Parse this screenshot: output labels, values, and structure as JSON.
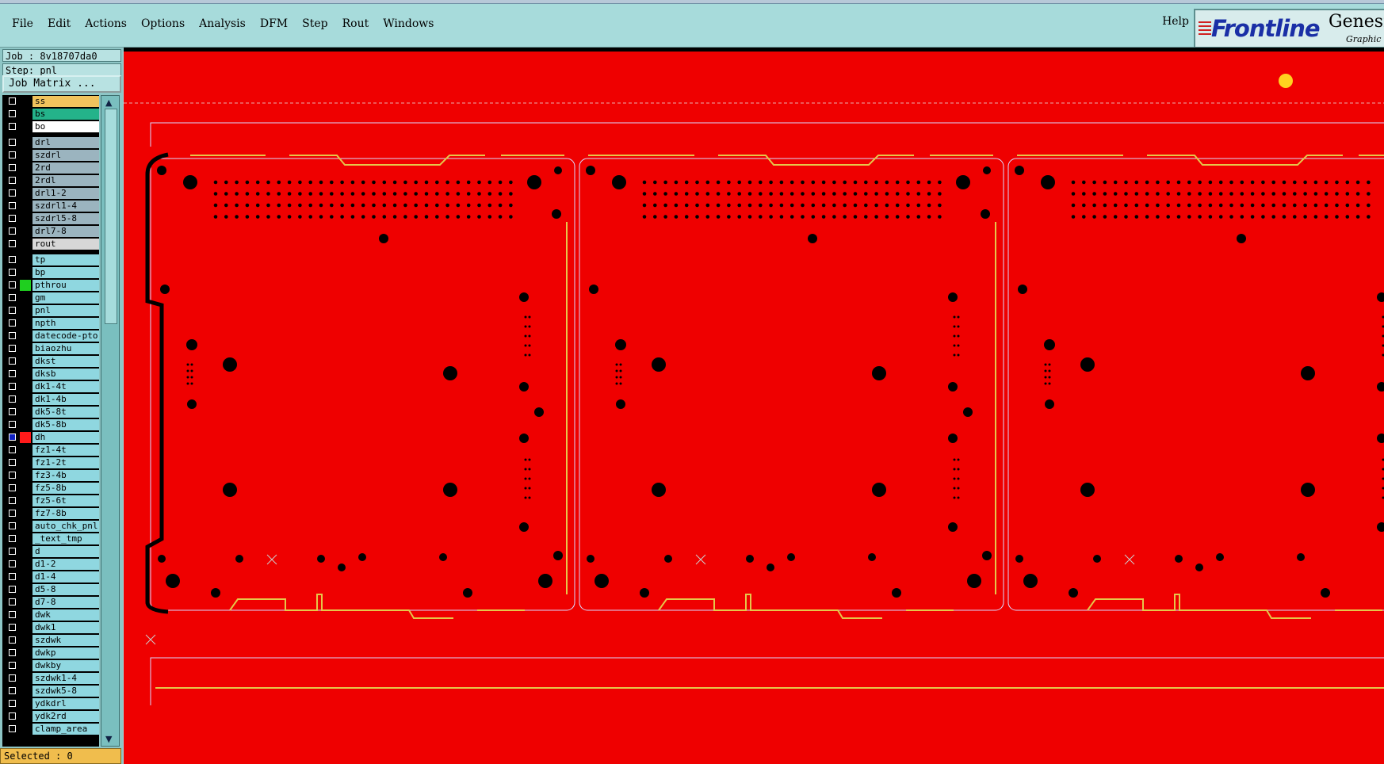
{
  "menu": [
    "File",
    "Edit",
    "Actions",
    "Options",
    "Analysis",
    "DFM",
    "Step",
    "Rout",
    "Windows"
  ],
  "help": "Help",
  "brand": {
    "logo": "Frontline",
    "product": "Genesi",
    "sub": "Graphic"
  },
  "job_label": "Job : 8v18707da0",
  "step_label": "Step: pnl",
  "matrix_button": "Job Matrix ...",
  "selected": "Selected : 0",
  "layers": [
    {
      "name": "ss",
      "color": "#f1c35d"
    },
    {
      "name": "bs",
      "color": "#24b38a"
    },
    {
      "name": "bo",
      "color": "#ffffff"
    },
    {
      "name": "drl",
      "color": "#9bb4bf"
    },
    {
      "name": "szdrl",
      "color": "#9bb4bf"
    },
    {
      "name": "2rd",
      "color": "#9bb4bf"
    },
    {
      "name": "2rdl",
      "color": "#9bb4bf"
    },
    {
      "name": "drl1-2",
      "color": "#9bb4bf"
    },
    {
      "name": "szdrl1-4",
      "color": "#9bb4bf"
    },
    {
      "name": "szdrl5-8",
      "color": "#9bb4bf"
    },
    {
      "name": "drl7-8",
      "color": "#9bb4bf"
    },
    {
      "name": "rout",
      "color": "#d7d7d7"
    },
    {
      "name": "tp",
      "color": "#8fd7e0"
    },
    {
      "name": "bp",
      "color": "#8fd7e0"
    },
    {
      "name": "pthrou",
      "color": "#8fd7e0",
      "swatch": "#1fcf1f"
    },
    {
      "name": "gm",
      "color": "#8fd7e0"
    },
    {
      "name": "pnl",
      "color": "#8fd7e0"
    },
    {
      "name": "npth",
      "color": "#8fd7e0"
    },
    {
      "name": "datecode-pto",
      "color": "#8fd7e0"
    },
    {
      "name": "biaozhu",
      "color": "#8fd7e0"
    },
    {
      "name": "dkst",
      "color": "#8fd7e0"
    },
    {
      "name": "dksb",
      "color": "#8fd7e0"
    },
    {
      "name": "dk1-4t",
      "color": "#8fd7e0"
    },
    {
      "name": "dk1-4b",
      "color": "#8fd7e0"
    },
    {
      "name": "dk5-8t",
      "color": "#8fd7e0"
    },
    {
      "name": "dk5-8b",
      "color": "#8fd7e0"
    },
    {
      "name": "dh",
      "color": "#8fd7e0",
      "swatch": "#ff1a1a",
      "active": true
    },
    {
      "name": "fz1-4t",
      "color": "#8fd7e0"
    },
    {
      "name": "fz1-2t",
      "color": "#8fd7e0"
    },
    {
      "name": "fz3-4b",
      "color": "#8fd7e0"
    },
    {
      "name": "fz5-8b",
      "color": "#8fd7e0"
    },
    {
      "name": "fz5-6t",
      "color": "#8fd7e0"
    },
    {
      "name": "fz7-8b",
      "color": "#8fd7e0"
    },
    {
      "name": "auto_chk_pnl",
      "color": "#8fd7e0"
    },
    {
      "name": "_text_tmp",
      "color": "#8fd7e0"
    },
    {
      "name": "d",
      "color": "#8fd7e0"
    },
    {
      "name": "d1-2",
      "color": "#8fd7e0"
    },
    {
      "name": "d1-4",
      "color": "#8fd7e0"
    },
    {
      "name": "d5-8",
      "color": "#8fd7e0"
    },
    {
      "name": "d7-8",
      "color": "#8fd7e0"
    },
    {
      "name": "dwk",
      "color": "#8fd7e0"
    },
    {
      "name": "dwk1",
      "color": "#8fd7e0"
    },
    {
      "name": "szdwk",
      "color": "#8fd7e0"
    },
    {
      "name": "dwkp",
      "color": "#8fd7e0"
    },
    {
      "name": "dwkby",
      "color": "#8fd7e0"
    },
    {
      "name": "szdwk1-4",
      "color": "#8fd7e0"
    },
    {
      "name": "szdwk5-8",
      "color": "#8fd7e0"
    },
    {
      "name": "ydkdrl",
      "color": "#8fd7e0"
    },
    {
      "name": "ydk2rd",
      "color": "#8fd7e0"
    },
    {
      "name": "clamp_area",
      "color": "#8fd7e0"
    }
  ],
  "colors": {
    "board_bg": "#ef0000",
    "outline": "#e6c64a",
    "hole": "#000000",
    "edge": "#d9d9ff",
    "panel_ui": "#a7dbdb"
  }
}
